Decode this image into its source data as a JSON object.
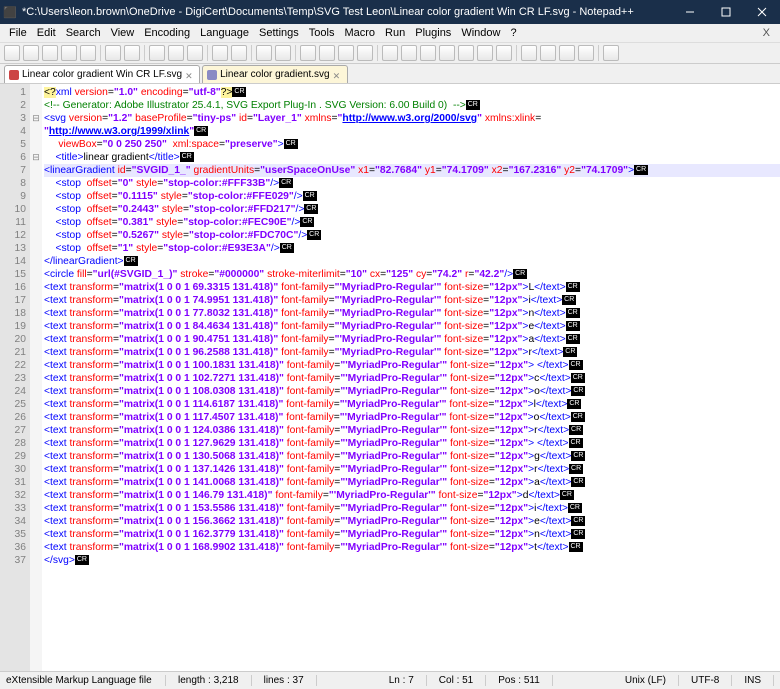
{
  "title": "*C:\\Users\\leon.brown\\OneDrive - DigiCert\\Documents\\Temp\\SVG Test Leon\\Linear color gradient Win CR LF.svg - Notepad++",
  "menus": [
    "File",
    "Edit",
    "Search",
    "View",
    "Encoding",
    "Language",
    "Settings",
    "Tools",
    "Macro",
    "Run",
    "Plugins",
    "Window",
    "?"
  ],
  "tabs": [
    {
      "label": "Linear color gradient Win CR LF.svg",
      "active": true
    },
    {
      "label": "Linear color gradient.svg",
      "active": false
    }
  ],
  "gutter_count": 37,
  "code_lines": [
    {
      "hl": false,
      "html": "<span class='c-proc'>&lt;?</span><span class='c-tag'>xml</span> <span class='c-attr'>version</span>=<span class='c-str'>\"1.0\"</span> <span class='c-attr'>encoding</span>=<span class='c-str'>\"utf-8\"</span><span class='c-proc'>?&gt;</span><span class='eol'>CR</span>"
    },
    {
      "hl": false,
      "html": "<span class='c-comm'>&lt;!-- Generator: Adobe Illustrator 25.4.1, SVG Export Plug-In . SVG Version: 6.00 Build 0)  --&gt;</span><span class='eol'>CR</span>"
    },
    {
      "hl": false,
      "html": "<span class='c-tag'>&lt;svg</span> <span class='c-attr'>version</span>=<span class='c-str'>\"1.2\"</span> <span class='c-attr'>baseProfile</span>=<span class='c-str'>\"tiny-ps\"</span> <span class='c-attr'>id</span>=<span class='c-str'>\"Layer_1\"</span> <span class='c-attr'>xmlns</span>=<span class='c-str'>\"<span class='c-link'>http://www.w3.org/2000/svg</span>\"</span> <span class='c-attr'>xmlns:xlink</span>="
    },
    {
      "hl": false,
      "html": "<span class='c-str'>\"<span class='c-link'>http://www.w3.org/1999/xlink</span>\"</span><span class='eol'>CR</span>"
    },
    {
      "hl": false,
      "html": "     <span class='c-attr'>viewBox</span>=<span class='c-str'>\"0 0 250 250\"</span>  <span class='c-attr'>xml:space</span>=<span class='c-str'>\"preserve\"</span><span class='c-tag'>&gt;</span><span class='eol'>CR</span>"
    },
    {
      "hl": false,
      "html": "    <span class='c-tag'>&lt;title&gt;</span><span class='c-text'>linear gradient</span><span class='c-tag'>&lt;/title&gt;</span><span class='eol'>CR</span>"
    },
    {
      "hl": true,
      "html": "<span class='c-tag'>&lt;linearGradient</span> <span class='c-attr'>id</span>=<span class='c-str'>\"SVGID_1_\"</span> <span class='c-attr'>gradientUnits</span>=<span class='c-str'>\"userSpaceOnUse\"</span> <span class='c-attr'>x1</span>=<span class='c-str'>\"82.7684\"</span> <span class='c-attr'>y1</span>=<span class='c-str'>\"74.1709\"</span> <span class='c-attr'>x2</span>=<span class='c-str'>\"167.2316\"</span> <span class='c-attr'>y2</span>=<span class='c-str'>\"74.1709\"</span><span class='c-tag'>&gt;</span><span class='eol'>CR</span>"
    },
    {
      "hl": false,
      "html": "    <span class='c-tag'>&lt;stop</span>  <span class='c-attr'>offset</span>=<span class='c-str'>\"0\"</span> <span class='c-attr'>style</span>=<span class='c-str'>\"stop-color:#FFF33B\"</span><span class='c-tag'>/&gt;</span><span class='eol'>CR</span>"
    },
    {
      "hl": false,
      "html": "    <span class='c-tag'>&lt;stop</span>  <span class='c-attr'>offset</span>=<span class='c-str'>\"0.1115\"</span> <span class='c-attr'>style</span>=<span class='c-str'>\"stop-color:#FFE029\"</span><span class='c-tag'>/&gt;</span><span class='eol'>CR</span>"
    },
    {
      "hl": false,
      "html": "    <span class='c-tag'>&lt;stop</span>  <span class='c-attr'>offset</span>=<span class='c-str'>\"0.2443\"</span> <span class='c-attr'>style</span>=<span class='c-str'>\"stop-color:#FFD217\"</span><span class='c-tag'>/&gt;</span><span class='eol'>CR</span>"
    },
    {
      "hl": false,
      "html": "    <span class='c-tag'>&lt;stop</span>  <span class='c-attr'>offset</span>=<span class='c-str'>\"0.381\"</span> <span class='c-attr'>style</span>=<span class='c-str'>\"stop-color:#FEC90E\"</span><span class='c-tag'>/&gt;</span><span class='eol'>CR</span>"
    },
    {
      "hl": false,
      "html": "    <span class='c-tag'>&lt;stop</span>  <span class='c-attr'>offset</span>=<span class='c-str'>\"0.5267\"</span> <span class='c-attr'>style</span>=<span class='c-str'>\"stop-color:#FDC70C\"</span><span class='c-tag'>/&gt;</span><span class='eol'>CR</span>"
    },
    {
      "hl": false,
      "html": "    <span class='c-tag'>&lt;stop</span>  <span class='c-attr'>offset</span>=<span class='c-str'>\"1\"</span> <span class='c-attr'>style</span>=<span class='c-str'>\"stop-color:#E93E3A\"</span><span class='c-tag'>/&gt;</span><span class='eol'>CR</span>"
    },
    {
      "hl": false,
      "html": "<span class='c-tag'>&lt;/linearGradient&gt;</span><span class='eol'>CR</span>"
    },
    {
      "hl": false,
      "html": "<span class='c-tag'>&lt;circle</span> <span class='c-attr'>fill</span>=<span class='c-str'>\"url(#SVGID_1_)\"</span> <span class='c-attr'>stroke</span>=<span class='c-str'>\"#000000\"</span> <span class='c-attr'>stroke-miterlimit</span>=<span class='c-str'>\"10\"</span> <span class='c-attr'>cx</span>=<span class='c-str'>\"125\"</span> <span class='c-attr'>cy</span>=<span class='c-str'>\"74.2\"</span> <span class='c-attr'>r</span>=<span class='c-str'>\"42.2\"</span><span class='c-tag'>/&gt;</span><span class='eol'>CR</span>"
    },
    {
      "hl": false,
      "html": "<span class='c-tag'>&lt;text</span> <span class='c-attr'>transform</span>=<span class='c-str'>\"matrix(1 0 0 1 69.3315 131.418)\"</span> <span class='c-attr'>font-family</span>=<span class='c-str'>\"'MyriadPro-Regular'\"</span> <span class='c-attr'>font-size</span>=<span class='c-str'>\"12px\"</span><span class='c-tag'>&gt;</span>L<span class='c-tag'>&lt;/text&gt;</span><span class='eol'>CR</span>"
    },
    {
      "hl": false,
      "html": "<span class='c-tag'>&lt;text</span> <span class='c-attr'>transform</span>=<span class='c-str'>\"matrix(1 0 0 1 74.9951 131.418)\"</span> <span class='c-attr'>font-family</span>=<span class='c-str'>\"'MyriadPro-Regular'\"</span> <span class='c-attr'>font-size</span>=<span class='c-str'>\"12px\"</span><span class='c-tag'>&gt;</span>i<span class='c-tag'>&lt;/text&gt;</span><span class='eol'>CR</span>"
    },
    {
      "hl": false,
      "html": "<span class='c-tag'>&lt;text</span> <span class='c-attr'>transform</span>=<span class='c-str'>\"matrix(1 0 0 1 77.8032 131.418)\"</span> <span class='c-attr'>font-family</span>=<span class='c-str'>\"'MyriadPro-Regular'\"</span> <span class='c-attr'>font-size</span>=<span class='c-str'>\"12px\"</span><span class='c-tag'>&gt;</span>n<span class='c-tag'>&lt;/text&gt;</span><span class='eol'>CR</span>"
    },
    {
      "hl": false,
      "html": "<span class='c-tag'>&lt;text</span> <span class='c-attr'>transform</span>=<span class='c-str'>\"matrix(1 0 0 1 84.4634 131.418)\"</span> <span class='c-attr'>font-family</span>=<span class='c-str'>\"'MyriadPro-Regular'\"</span> <span class='c-attr'>font-size</span>=<span class='c-str'>\"12px\"</span><span class='c-tag'>&gt;</span>e<span class='c-tag'>&lt;/text&gt;</span><span class='eol'>CR</span>"
    },
    {
      "hl": false,
      "html": "<span class='c-tag'>&lt;text</span> <span class='c-attr'>transform</span>=<span class='c-str'>\"matrix(1 0 0 1 90.4751 131.418)\"</span> <span class='c-attr'>font-family</span>=<span class='c-str'>\"'MyriadPro-Regular'\"</span> <span class='c-attr'>font-size</span>=<span class='c-str'>\"12px\"</span><span class='c-tag'>&gt;</span>a<span class='c-tag'>&lt;/text&gt;</span><span class='eol'>CR</span>"
    },
    {
      "hl": false,
      "html": "<span class='c-tag'>&lt;text</span> <span class='c-attr'>transform</span>=<span class='c-str'>\"matrix(1 0 0 1 96.2588 131.418)\"</span> <span class='c-attr'>font-family</span>=<span class='c-str'>\"'MyriadPro-Regular'\"</span> <span class='c-attr'>font-size</span>=<span class='c-str'>\"12px\"</span><span class='c-tag'>&gt;</span>r<span class='c-tag'>&lt;/text&gt;</span><span class='eol'>CR</span>"
    },
    {
      "hl": false,
      "html": "<span class='c-tag'>&lt;text</span> <span class='c-attr'>transform</span>=<span class='c-str'>\"matrix(1 0 0 1 100.1831 131.418)\"</span> <span class='c-attr'>font-family</span>=<span class='c-str'>\"'MyriadPro-Regular'\"</span> <span class='c-attr'>font-size</span>=<span class='c-str'>\"12px\"</span><span class='c-tag'>&gt;</span> <span class='c-tag'>&lt;/text&gt;</span><span class='eol'>CR</span>"
    },
    {
      "hl": false,
      "html": "<span class='c-tag'>&lt;text</span> <span class='c-attr'>transform</span>=<span class='c-str'>\"matrix(1 0 0 1 102.7271 131.418)\"</span> <span class='c-attr'>font-family</span>=<span class='c-str'>\"'MyriadPro-Regular'\"</span> <span class='c-attr'>font-size</span>=<span class='c-str'>\"12px\"</span><span class='c-tag'>&gt;</span>c<span class='c-tag'>&lt;/text&gt;</span><span class='eol'>CR</span>"
    },
    {
      "hl": false,
      "html": "<span class='c-tag'>&lt;text</span> <span class='c-attr'>transform</span>=<span class='c-str'>\"matrix(1 0 0 1 108.0308 131.418)\"</span> <span class='c-attr'>font-family</span>=<span class='c-str'>\"'MyriadPro-Regular'\"</span> <span class='c-attr'>font-size</span>=<span class='c-str'>\"12px\"</span><span class='c-tag'>&gt;</span>o<span class='c-tag'>&lt;/text&gt;</span><span class='eol'>CR</span>"
    },
    {
      "hl": false,
      "html": "<span class='c-tag'>&lt;text</span> <span class='c-attr'>transform</span>=<span class='c-str'>\"matrix(1 0 0 1 114.6187 131.418)\"</span> <span class='c-attr'>font-family</span>=<span class='c-str'>\"'MyriadPro-Regular'\"</span> <span class='c-attr'>font-size</span>=<span class='c-str'>\"12px\"</span><span class='c-tag'>&gt;</span>l<span class='c-tag'>&lt;/text&gt;</span><span class='eol'>CR</span>"
    },
    {
      "hl": false,
      "html": "<span class='c-tag'>&lt;text</span> <span class='c-attr'>transform</span>=<span class='c-str'>\"matrix(1 0 0 1 117.4507 131.418)\"</span> <span class='c-attr'>font-family</span>=<span class='c-str'>\"'MyriadPro-Regular'\"</span> <span class='c-attr'>font-size</span>=<span class='c-str'>\"12px\"</span><span class='c-tag'>&gt;</span>o<span class='c-tag'>&lt;/text&gt;</span><span class='eol'>CR</span>"
    },
    {
      "hl": false,
      "html": "<span class='c-tag'>&lt;text</span> <span class='c-attr'>transform</span>=<span class='c-str'>\"matrix(1 0 0 1 124.0386 131.418)\"</span> <span class='c-attr'>font-family</span>=<span class='c-str'>\"'MyriadPro-Regular'\"</span> <span class='c-attr'>font-size</span>=<span class='c-str'>\"12px\"</span><span class='c-tag'>&gt;</span>r<span class='c-tag'>&lt;/text&gt;</span><span class='eol'>CR</span>"
    },
    {
      "hl": false,
      "html": "<span class='c-tag'>&lt;text</span> <span class='c-attr'>transform</span>=<span class='c-str'>\"matrix(1 0 0 1 127.9629 131.418)\"</span> <span class='c-attr'>font-family</span>=<span class='c-str'>\"'MyriadPro-Regular'\"</span> <span class='c-attr'>font-size</span>=<span class='c-str'>\"12px\"</span><span class='c-tag'>&gt;</span> <span class='c-tag'>&lt;/text&gt;</span><span class='eol'>CR</span>"
    },
    {
      "hl": false,
      "html": "<span class='c-tag'>&lt;text</span> <span class='c-attr'>transform</span>=<span class='c-str'>\"matrix(1 0 0 1 130.5068 131.418)\"</span> <span class='c-attr'>font-family</span>=<span class='c-str'>\"'MyriadPro-Regular'\"</span> <span class='c-attr'>font-size</span>=<span class='c-str'>\"12px\"</span><span class='c-tag'>&gt;</span>g<span class='c-tag'>&lt;/text&gt;</span><span class='eol'>CR</span>"
    },
    {
      "hl": false,
      "html": "<span class='c-tag'>&lt;text</span> <span class='c-attr'>transform</span>=<span class='c-str'>\"matrix(1 0 0 1 137.1426 131.418)\"</span> <span class='c-attr'>font-family</span>=<span class='c-str'>\"'MyriadPro-Regular'\"</span> <span class='c-attr'>font-size</span>=<span class='c-str'>\"12px\"</span><span class='c-tag'>&gt;</span>r<span class='c-tag'>&lt;/text&gt;</span><span class='eol'>CR</span>"
    },
    {
      "hl": false,
      "html": "<span class='c-tag'>&lt;text</span> <span class='c-attr'>transform</span>=<span class='c-str'>\"matrix(1 0 0 1 141.0068 131.418)\"</span> <span class='c-attr'>font-family</span>=<span class='c-str'>\"'MyriadPro-Regular'\"</span> <span class='c-attr'>font-size</span>=<span class='c-str'>\"12px\"</span><span class='c-tag'>&gt;</span>a<span class='c-tag'>&lt;/text&gt;</span><span class='eol'>CR</span>"
    },
    {
      "hl": false,
      "html": "<span class='c-tag'>&lt;text</span> <span class='c-attr'>transform</span>=<span class='c-str'>\"matrix(1 0 0 1 146.79 131.418)\"</span> <span class='c-attr'>font-family</span>=<span class='c-str'>\"'MyriadPro-Regular'\"</span> <span class='c-attr'>font-size</span>=<span class='c-str'>\"12px\"</span><span class='c-tag'>&gt;</span>d<span class='c-tag'>&lt;/text&gt;</span><span class='eol'>CR</span>"
    },
    {
      "hl": false,
      "html": "<span class='c-tag'>&lt;text</span> <span class='c-attr'>transform</span>=<span class='c-str'>\"matrix(1 0 0 1 153.5586 131.418)\"</span> <span class='c-attr'>font-family</span>=<span class='c-str'>\"'MyriadPro-Regular'\"</span> <span class='c-attr'>font-size</span>=<span class='c-str'>\"12px\"</span><span class='c-tag'>&gt;</span>i<span class='c-tag'>&lt;/text&gt;</span><span class='eol'>CR</span>"
    },
    {
      "hl": false,
      "html": "<span class='c-tag'>&lt;text</span> <span class='c-attr'>transform</span>=<span class='c-str'>\"matrix(1 0 0 1 156.3662 131.418)\"</span> <span class='c-attr'>font-family</span>=<span class='c-str'>\"'MyriadPro-Regular'\"</span> <span class='c-attr'>font-size</span>=<span class='c-str'>\"12px\"</span><span class='c-tag'>&gt;</span>e<span class='c-tag'>&lt;/text&gt;</span><span class='eol'>CR</span>"
    },
    {
      "hl": false,
      "html": "<span class='c-tag'>&lt;text</span> <span class='c-attr'>transform</span>=<span class='c-str'>\"matrix(1 0 0 1 162.3779 131.418)\"</span> <span class='c-attr'>font-family</span>=<span class='c-str'>\"'MyriadPro-Regular'\"</span> <span class='c-attr'>font-size</span>=<span class='c-str'>\"12px\"</span><span class='c-tag'>&gt;</span>n<span class='c-tag'>&lt;/text&gt;</span><span class='eol'>CR</span>"
    },
    {
      "hl": false,
      "html": "<span class='c-tag'>&lt;text</span> <span class='c-attr'>transform</span>=<span class='c-str'>\"matrix(1 0 0 1 168.9902 131.418)\"</span> <span class='c-attr'>font-family</span>=<span class='c-str'>\"'MyriadPro-Regular'\"</span> <span class='c-attr'>font-size</span>=<span class='c-str'>\"12px\"</span><span class='c-tag'>&gt;</span>t<span class='c-tag'>&lt;/text&gt;</span><span class='eol'>CR</span>"
    },
    {
      "hl": false,
      "html": "<span class='c-tag'>&lt;/svg&gt;</span><span class='eol'>CR</span>"
    },
    {
      "hl": false,
      "html": ""
    }
  ],
  "status": {
    "lang": "eXtensible Markup Language file",
    "length": "length : 3,218",
    "lines": "lines : 37",
    "ln": "Ln : 7",
    "col": "Col : 51",
    "pos": "Pos : 511",
    "eol": "Unix (LF)",
    "enc": "UTF-8",
    "ins": "INS"
  }
}
